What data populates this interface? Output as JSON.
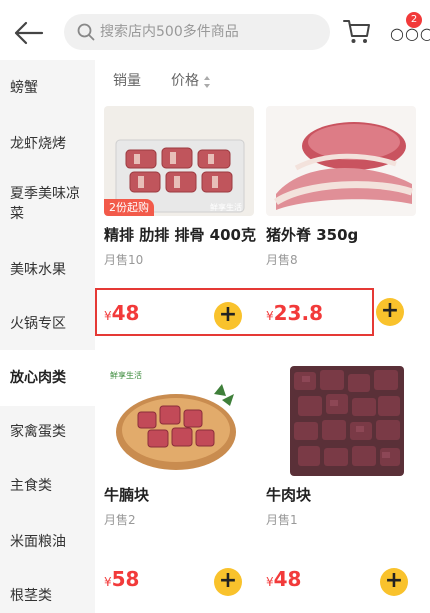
{
  "header": {
    "search_placeholder": "搜索店内500多件商品",
    "cart_badge_count": "",
    "more_badge": "2"
  },
  "sidebar": {
    "items": [
      {
        "label": "螃蟹",
        "active": false
      },
      {
        "label": "龙虾烧烤",
        "active": false
      },
      {
        "label": "夏季美味凉菜",
        "active": false
      },
      {
        "label": "美味水果",
        "active": false
      },
      {
        "label": "火锅专区",
        "active": false
      },
      {
        "label": "放心肉类",
        "active": true
      },
      {
        "label": "家禽蛋类",
        "active": false
      },
      {
        "label": "主食类",
        "active": false
      },
      {
        "label": "米面粮油",
        "active": false
      },
      {
        "label": "根茎类",
        "active": false
      }
    ]
  },
  "sort": {
    "sales_label": "销量",
    "price_label": "价格"
  },
  "products": [
    {
      "name": "精排 肋排  排骨 400克",
      "sold": "月售10",
      "currency": "¥",
      "price": "48",
      "tag": "2份起购",
      "image": "pork-ribs",
      "thumb_text": "鲜享生活"
    },
    {
      "name": "猪外脊  350g",
      "sold": "月售8",
      "currency": "¥",
      "price": "23.8",
      "tag": "",
      "image": "pork-loin",
      "thumb_text": ""
    },
    {
      "name": "牛腩块",
      "sold": "月售2",
      "currency": "¥",
      "price": "58",
      "tag": "",
      "image": "beef-brisket",
      "thumb_text": "鲜享生活"
    },
    {
      "name": "牛肉块",
      "sold": "月售1",
      "currency": "¥",
      "price": "48",
      "tag": "",
      "image": "beef-cubes",
      "thumb_text": ""
    }
  ],
  "colors": {
    "accent": "#f23a3a",
    "add_button": "#f9c22c",
    "highlight_box": "#e53935"
  },
  "icons": [
    "back-arrow-icon",
    "search-icon",
    "cart-icon",
    "more-icon",
    "plus-icon"
  ]
}
